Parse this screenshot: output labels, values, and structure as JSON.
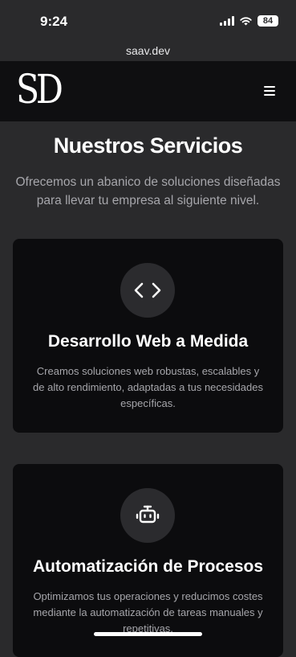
{
  "status_bar": {
    "time": "9:24",
    "battery": "84"
  },
  "browser": {
    "url": "saav.dev"
  },
  "header": {
    "logo": "SD"
  },
  "hero": {
    "title": "Nuestros Servicios",
    "subtitle": "Ofrecemos un abanico de soluciones diseñadas para llevar tu empresa al siguiente nivel."
  },
  "services": [
    {
      "icon": "code-icon",
      "title": "Desarrollo Web a Medida",
      "description": "Creamos soluciones web robustas, escalables y de alto rendimiento, adaptadas a tus necesidades específicas."
    },
    {
      "icon": "robot-icon",
      "title": "Automatización de Procesos",
      "description": "Optimizamos tus operaciones y reducimos costes mediante la automatización de tareas manuales y repetitivas."
    }
  ],
  "colors": {
    "background": "#2a2a2c",
    "header": "#0f0f11",
    "card": "#0c0c0e",
    "muted_text": "#a6a6ab"
  }
}
